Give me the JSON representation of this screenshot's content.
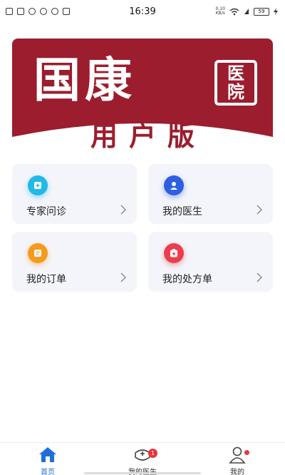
{
  "status_bar": {
    "time": "16:39",
    "net_speed_value": "0.10",
    "net_speed_unit": "KB/s",
    "battery": "59"
  },
  "banner": {
    "title": "国康",
    "seal_line1": "医",
    "seal_line2": "院",
    "subtitle": "用户版",
    "colors": {
      "brand_red": "#9b1d2e"
    }
  },
  "cards": [
    {
      "label": "专家问诊",
      "icon": "plus-document-icon",
      "color": "#21b8ea"
    },
    {
      "label": "我的医生",
      "icon": "doctor-icon",
      "color": "#2d5fe0"
    },
    {
      "label": "我的订单",
      "icon": "order-icon",
      "color": "#f59a1c"
    },
    {
      "label": "我的处方单",
      "icon": "prescription-icon",
      "color": "#ec3d4e"
    }
  ],
  "bottom_nav": {
    "items": [
      {
        "label": "首页",
        "icon": "home-icon",
        "active": true
      },
      {
        "label": "我的医生",
        "icon": "doctor-cap-icon",
        "badge": "1"
      },
      {
        "label": "我的",
        "icon": "user-icon"
      }
    ],
    "active_color": "#1e6fd9"
  }
}
